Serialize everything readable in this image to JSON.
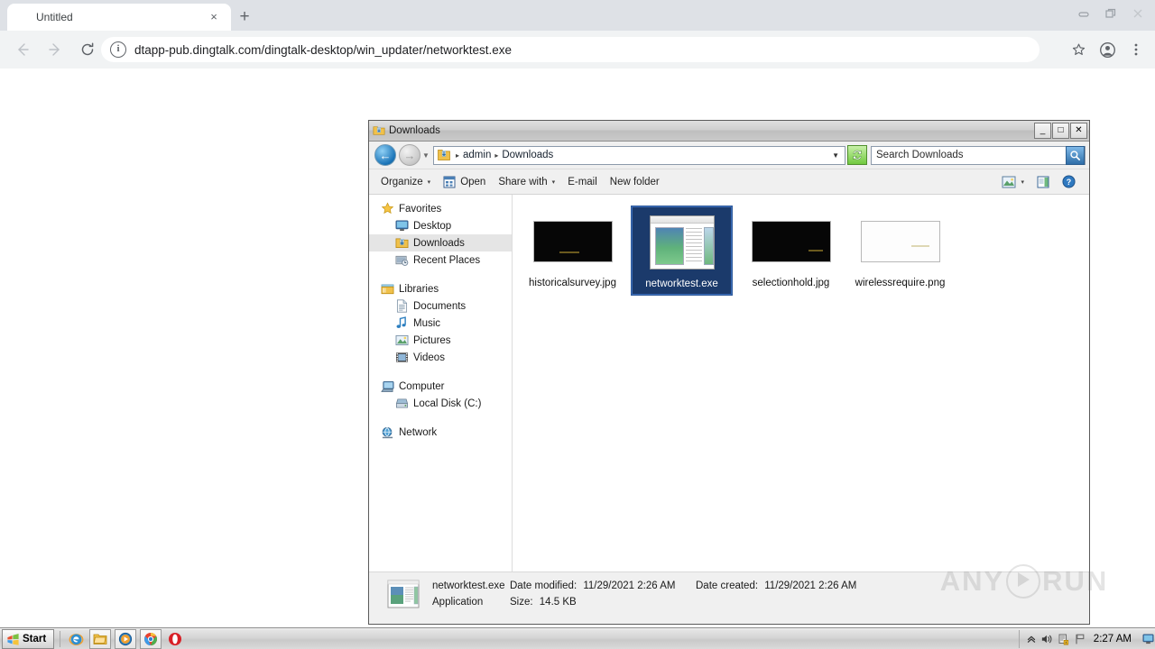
{
  "browser": {
    "tab_title": "Untitled",
    "tab_close_label": "×",
    "new_tab_label": "+",
    "url": "dtapp-pub.dingtalk.com/dingtalk-desktop/win_updater/networktest.exe",
    "info_glyph": "i",
    "nav": {
      "back": "←",
      "forward": "→",
      "reload": "⟳"
    },
    "right_icons": [
      "star-icon",
      "profile-icon",
      "menu-icon"
    ],
    "window_controls": [
      "minimize",
      "restore",
      "close"
    ]
  },
  "explorer": {
    "title": "Downloads",
    "title_buttons": {
      "minimize": "_",
      "maximize": "□",
      "close": "✕"
    },
    "address": {
      "back_glyph": "←",
      "forward_glyph": "→",
      "recent_glyph": "▼",
      "crumbs": [
        "admin",
        "Downloads"
      ],
      "crumb_sep": "▸",
      "dropdown_glyph": "▼",
      "refresh_glyph": "⟳",
      "search_placeholder": "Search Downloads",
      "search_icon": "🔍"
    },
    "toolbar": {
      "organize": "Organize",
      "open": "Open",
      "share_with": "Share with",
      "email": "E-mail",
      "new_folder": "New folder",
      "caret": "▾"
    },
    "navpane": {
      "groups": [
        {
          "header": {
            "label": "Favorites",
            "icon": "star-icon"
          },
          "items": [
            {
              "label": "Desktop",
              "icon": "desktop-icon",
              "selected": false
            },
            {
              "label": "Downloads",
              "icon": "downloads-icon",
              "selected": true
            },
            {
              "label": "Recent Places",
              "icon": "recent-places-icon",
              "selected": false
            }
          ]
        },
        {
          "header": {
            "label": "Libraries",
            "icon": "libraries-icon"
          },
          "items": [
            {
              "label": "Documents",
              "icon": "document-icon",
              "selected": false
            },
            {
              "label": "Music",
              "icon": "music-icon",
              "selected": false
            },
            {
              "label": "Pictures",
              "icon": "pictures-icon",
              "selected": false
            },
            {
              "label": "Videos",
              "icon": "videos-icon",
              "selected": false
            }
          ]
        },
        {
          "header": {
            "label": "Computer",
            "icon": "computer-icon"
          },
          "items": [
            {
              "label": "Local Disk (C:)",
              "icon": "disk-icon",
              "selected": false
            }
          ]
        },
        {
          "header": {
            "label": "Network",
            "icon": "network-icon"
          },
          "items": []
        }
      ]
    },
    "files": [
      {
        "name": "historicalsurvey.jpg",
        "kind": "image-dark",
        "selected": false
      },
      {
        "name": "networktest.exe",
        "kind": "exe",
        "selected": true
      },
      {
        "name": "selectionhold.jpg",
        "kind": "image-dark",
        "selected": false
      },
      {
        "name": "wirelessrequire.png",
        "kind": "image-light",
        "selected": false
      }
    ],
    "details": {
      "file_name": "networktest.exe",
      "date_modified_label": "Date modified:",
      "date_modified_value": "11/29/2021 2:26 AM",
      "date_created_label": "Date created:",
      "date_created_value": "11/29/2021 2:26 AM",
      "type": "Application",
      "size_label": "Size:",
      "size_value": "14.5 KB"
    }
  },
  "watermark": {
    "left": "ANY",
    "right": "RUN"
  },
  "taskbar": {
    "start_label": "Start",
    "quicklaunch": [
      "internet-explorer-icon",
      "explorer-icon",
      "media-player-icon",
      "chrome-icon",
      "opera-icon"
    ],
    "tray": [
      "show-hidden-icon",
      "volume-icon",
      "action-center-icon",
      "network-flag-icon"
    ],
    "clock": "2:27 AM",
    "show_hidden_glyph": "«"
  }
}
